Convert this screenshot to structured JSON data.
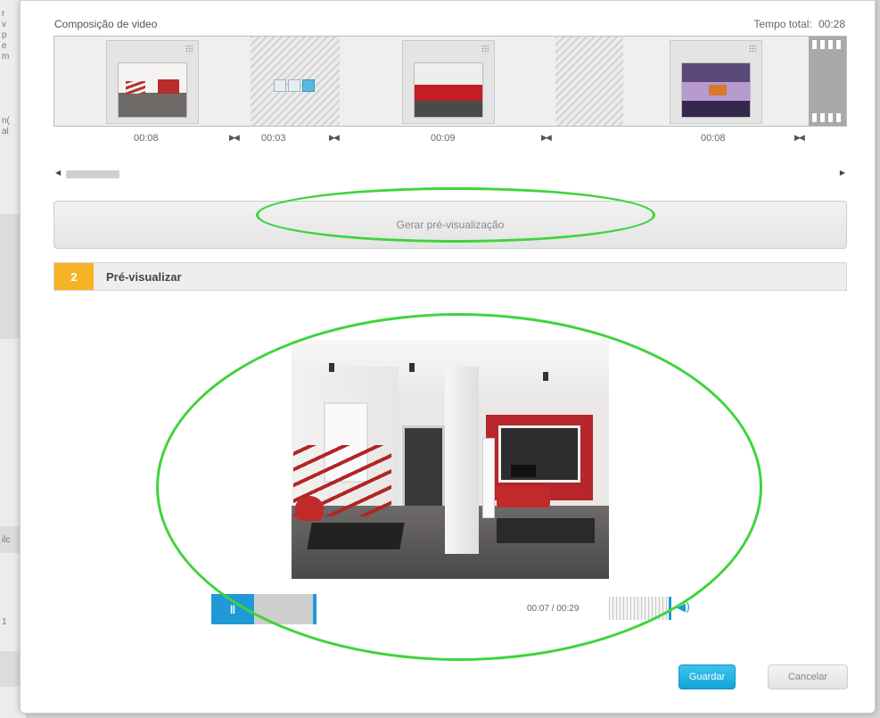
{
  "background_page": {
    "fragments": [
      "r",
      "v",
      "p",
      "e",
      "m",
      "n(",
      "al",
      "ilc",
      "1"
    ]
  },
  "composition": {
    "title": "Composição de video",
    "total_label": "Tempo total:",
    "total_value": "00:28",
    "clips": [
      {
        "duration": "00:08",
        "thumb": "living-room-white-red"
      },
      {
        "duration": "00:09",
        "thumb": "kitchen-red"
      },
      {
        "duration": "00:08",
        "thumb": "bedroom-purple"
      }
    ],
    "transitions": [
      {
        "duration": "00:03"
      },
      {
        "duration": ""
      }
    ],
    "transition_icon": "bowtie-icon"
  },
  "generate_button": "Gerar pré-visualização",
  "step": {
    "number": "2",
    "title": "Pré-visualizar"
  },
  "player": {
    "play_glyph": "‖",
    "time": "00:07 / 00:29",
    "progress_fraction": 0.24,
    "volume_fraction": 1.0
  },
  "buttons": {
    "save": "Guardar",
    "cancel": "Cancelar"
  },
  "colors": {
    "accent": "#1f9ad6",
    "step_badge": "#f5b325",
    "highlight_ellipse": "#3fd43b"
  }
}
